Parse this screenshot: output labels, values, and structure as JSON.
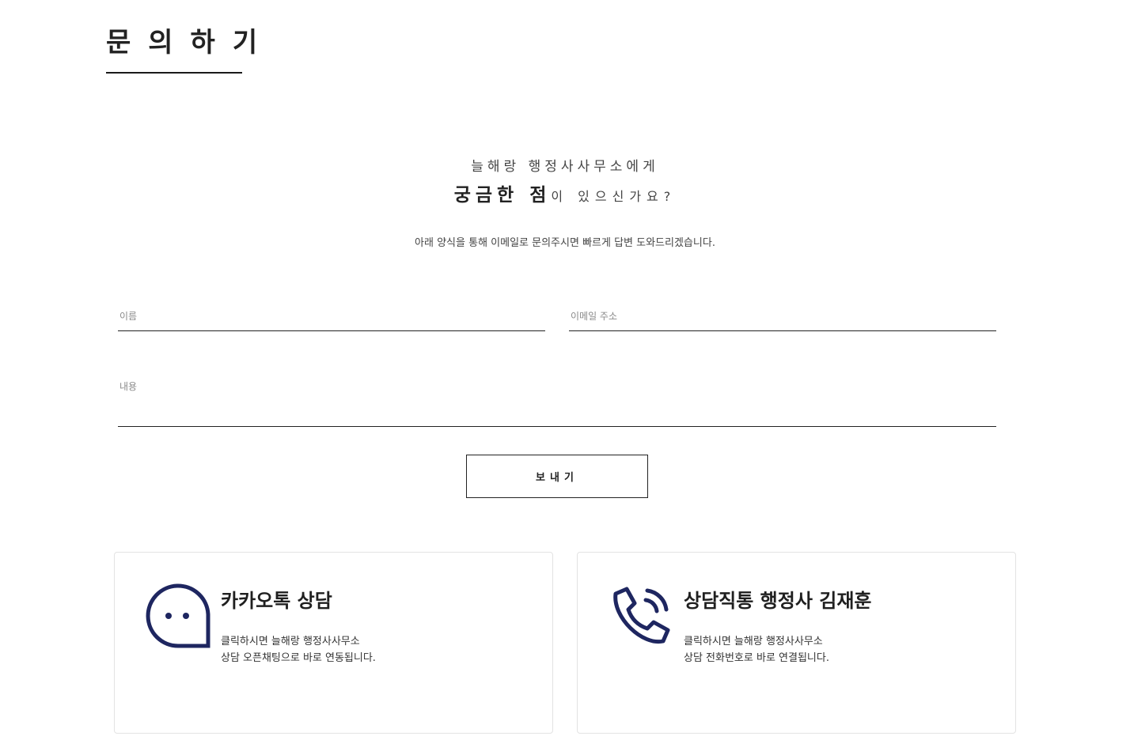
{
  "header": {
    "title": "문의하기"
  },
  "intro": {
    "subtitle": "늘해랑 행정사사무소에게",
    "headline_strong": "궁금한 점",
    "headline_rest": "이 있으신가요?",
    "description": "아래 양식을 통해 이메일로 문의주시면 빠르게 답변 도와드리겠습니다."
  },
  "form": {
    "name_placeholder": "이름",
    "email_placeholder": "이메일 주소",
    "message_placeholder": "내용",
    "submit_label": "보내기"
  },
  "cards": [
    {
      "title": "카카오톡 상담",
      "desc_line1": "클릭하시면 늘해랑 행정사사무소",
      "desc_line2": "상담 오픈채팅으로 바로 연동됩니다.",
      "icon": "chat-bubble-icon"
    },
    {
      "title": "상담직통 행정사 김재훈",
      "desc_line1": "클릭하시면 늘해랑 행정사사무소",
      "desc_line2": "상담 전화번호로 바로 연결됩니다.",
      "icon": "phone-call-icon"
    }
  ],
  "colors": {
    "accent": "#1e2660",
    "text": "#222222",
    "border": "#e3e3e3"
  }
}
